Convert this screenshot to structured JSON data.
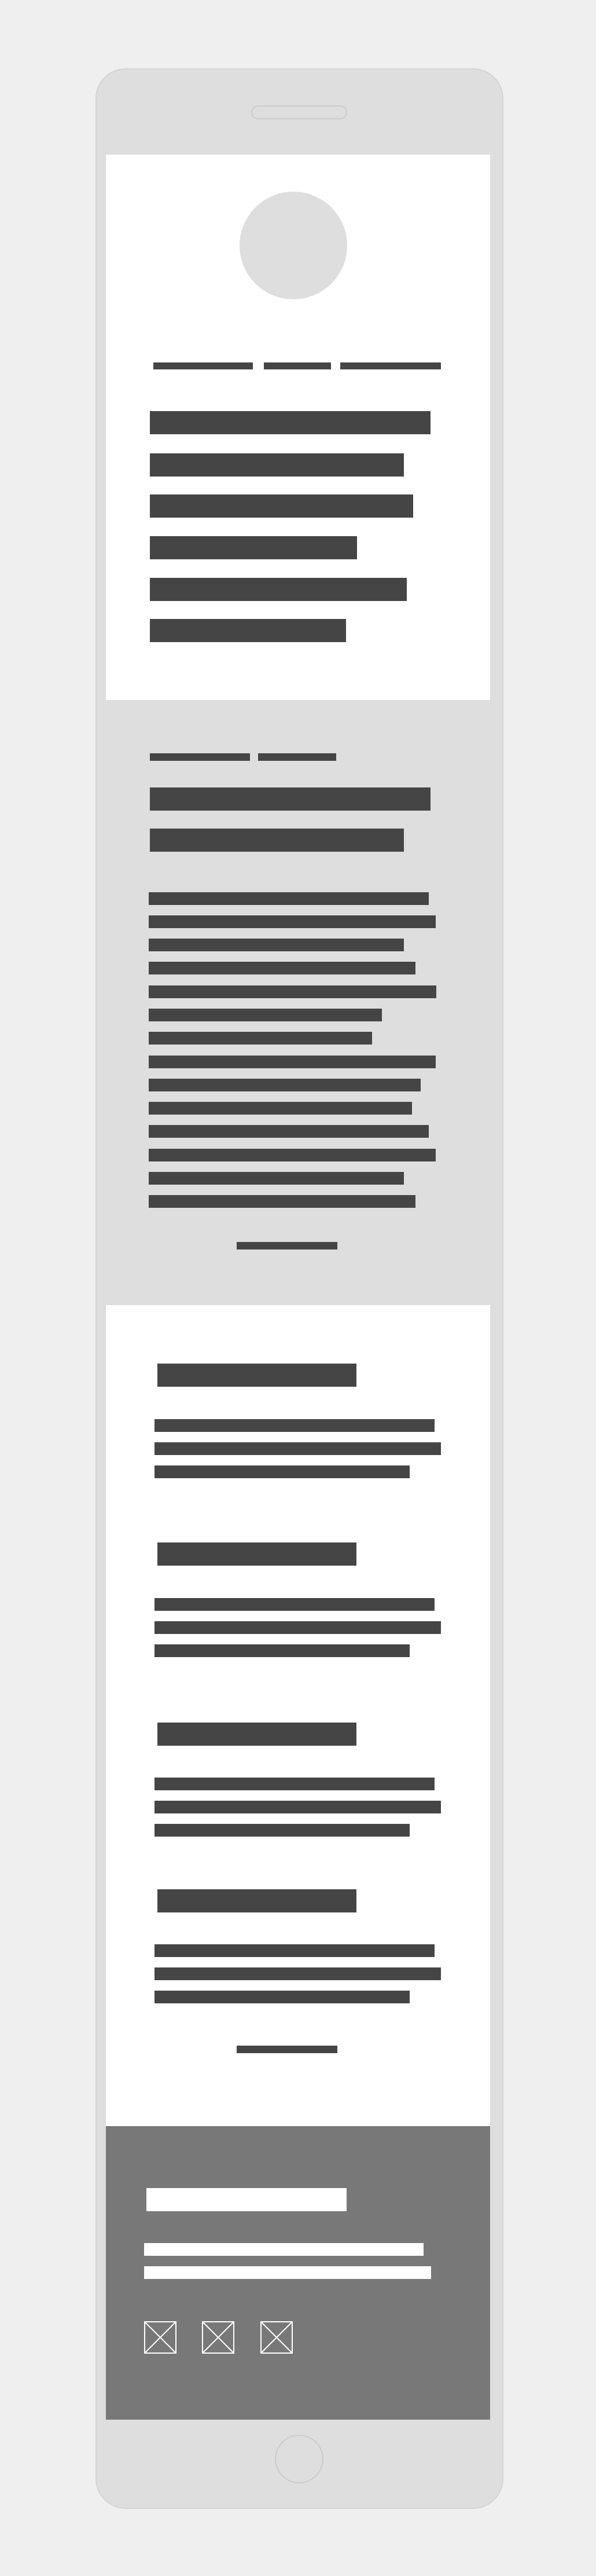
{
  "wireframe": {
    "style": "placeholder blocks, no readable text",
    "colors": {
      "page_background": "#efefef",
      "phone_body": "#dedede",
      "content_white": "#ffffff",
      "placeholder_dark": "#454545",
      "footer_background": "#787878"
    }
  },
  "footer": {
    "social_icons": [
      "placeholder-image-icon",
      "placeholder-image-icon",
      "placeholder-image-icon"
    ]
  }
}
